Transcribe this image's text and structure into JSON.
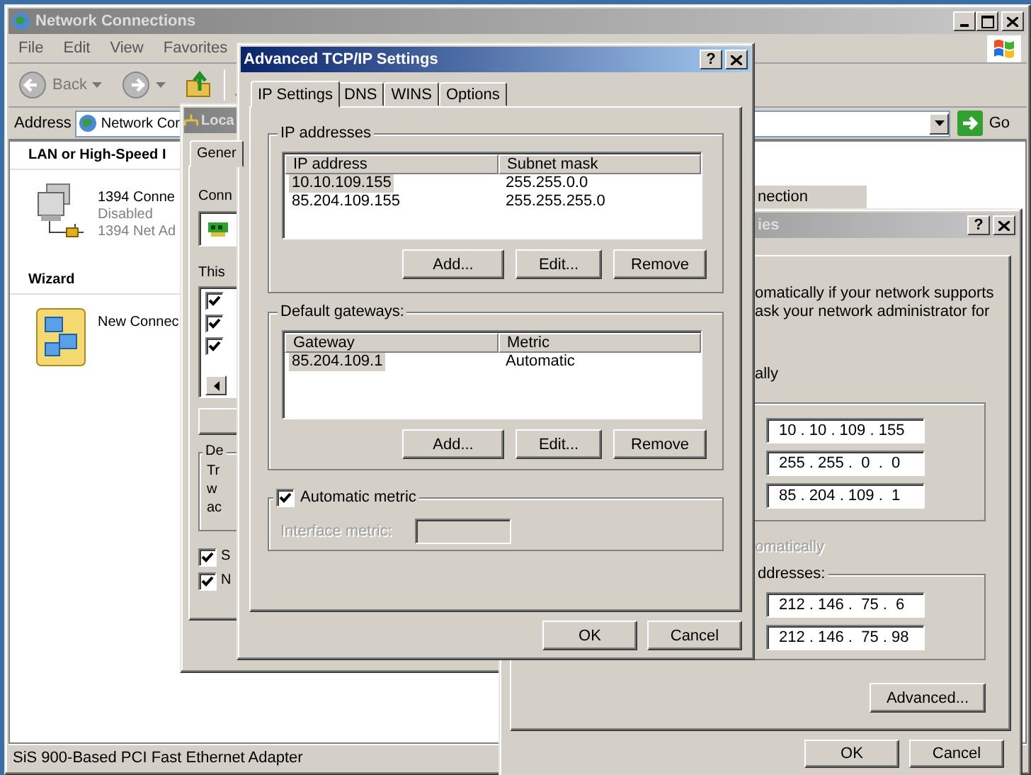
{
  "main_window": {
    "title": "Network Connections",
    "active": false,
    "menu": [
      {
        "label": "File"
      },
      {
        "label": "Edit"
      },
      {
        "label": "View"
      },
      {
        "label": "Favorites"
      }
    ],
    "toolbar": {
      "back_label": "Back"
    },
    "address": {
      "label": "Address",
      "value": "Network Cor",
      "go_label": "Go"
    },
    "sections": [
      {
        "title": "LAN or High-Speed I",
        "items": [
          {
            "kind": "network",
            "lines": [
              "1394 Conne",
              "Disabled",
              "1394 Net Ad"
            ]
          }
        ]
      },
      {
        "title": "Wizard",
        "items": [
          {
            "kind": "wizard",
            "lines": [
              "New Connec"
            ]
          }
        ]
      }
    ],
    "status_bar": "SiS 900-Based PCI Fast Ethernet Adapter"
  },
  "background_window": {
    "title": "nection"
  },
  "local_window": {
    "title": "Loca",
    "active": false,
    "tab": "Gener",
    "connect_label": "Conn",
    "components_label": "This",
    "component_rows": [
      {
        "checked": true
      },
      {
        "checked": true
      },
      {
        "checked": true
      }
    ],
    "description": {
      "legend": "De",
      "lines": [
        "Tr",
        "w",
        "ac"
      ]
    },
    "options": [
      {
        "label": "S",
        "checked": true
      },
      {
        "label": "N",
        "checked": true
      }
    ]
  },
  "tcpip_window": {
    "title": "ies",
    "active": false,
    "help": "?",
    "intro": "omatically if your network supports\nask your network administrator for",
    "manual_option": "ally",
    "ip_fields": [
      "10 . 10 . 109 . 155",
      "255 . 255 .  0  .  0",
      "85 . 204 . 109 .  1"
    ],
    "dns_auto": "omatically",
    "dns_legend": "ddresses:",
    "dns_fields": [
      "212 . 146 .  75 .  6",
      "212 . 146 .  75 . 98"
    ],
    "advanced_button": "Advanced...",
    "buttons": [
      "OK",
      "Cancel"
    ]
  },
  "advanced_window": {
    "title": "Advanced TCP/IP Settings",
    "active": true,
    "help": "?",
    "tabs": [
      {
        "label": "IP Settings",
        "selected": true
      },
      {
        "label": "DNS",
        "selected": false
      },
      {
        "label": "WINS",
        "selected": false
      },
      {
        "label": "Options",
        "selected": false
      }
    ],
    "ip_addresses": {
      "legend": "IP addresses",
      "columns": [
        "IP address",
        "Subnet mask"
      ],
      "rows": [
        {
          "cells": [
            "10.10.109.155",
            "255.255.0.0"
          ],
          "selected": true
        },
        {
          "cells": [
            "85.204.109.155",
            "255.255.255.0"
          ],
          "selected": false
        }
      ],
      "buttons": [
        "Add...",
        "Edit...",
        "Remove"
      ]
    },
    "gateways": {
      "legend": "Default gateways:",
      "columns": [
        "Gateway",
        "Metric"
      ],
      "rows": [
        {
          "cells": [
            "85.204.109.1",
            "Automatic"
          ],
          "selected": true
        }
      ],
      "buttons": [
        "Add...",
        "Edit...",
        "Remove"
      ]
    },
    "automatic_metric": {
      "label": "Automatic metric",
      "checked": true,
      "field_label": "Interface metric:"
    },
    "buttons": [
      "OK",
      "Cancel"
    ]
  }
}
